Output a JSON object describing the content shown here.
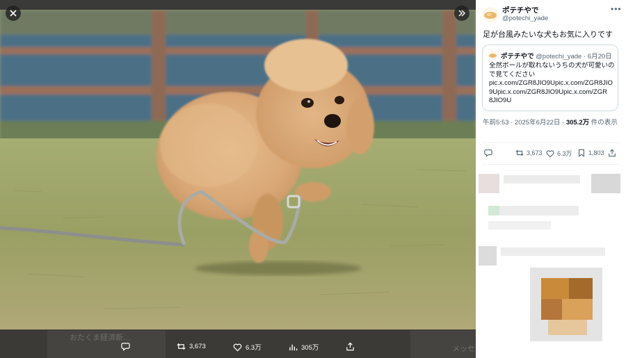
{
  "viewer": {
    "ghost_text_left": "おたくま経済新…",
    "ghost_text_right": "メッセ",
    "actions": {
      "reply_icon": "comment-icon",
      "retweet_count": "3,673",
      "like_count": "6.3万",
      "views_count": "305万",
      "share_icon": "share-icon"
    }
  },
  "tweet": {
    "author_name": "ポテチやで",
    "author_handle": "@potechi_yade",
    "text": "足が台風みたいな犬もお気に入りです",
    "quote": {
      "author_name": "ポテチやで",
      "author_handle": "@potechi_yade",
      "date": "6月20日",
      "lines": [
        "全然ボールが取れないうちの犬が可愛いの",
        "で見てください",
        "pic.x.com/ZGR8JIO9Upic.x.com/ZGR8JIO",
        "9Upic.x.com/ZGR8JIO9Upic.x.com/ZGR",
        "8JIO9U"
      ]
    },
    "meta_prefix": "午前5:53 · 2025年6月22日 · ",
    "views_bold": "305.2万",
    "meta_suffix": " 件の表示",
    "stats": {
      "retweets": "3,673",
      "likes": "6.3万",
      "bookmarks": "1,803"
    }
  },
  "colors": {
    "viewer_bg": "#1a1a1a",
    "action_bar": "#3b3a36",
    "text_primary": "#0f1419",
    "text_secondary": "#536471",
    "border": "#cfd9de"
  }
}
